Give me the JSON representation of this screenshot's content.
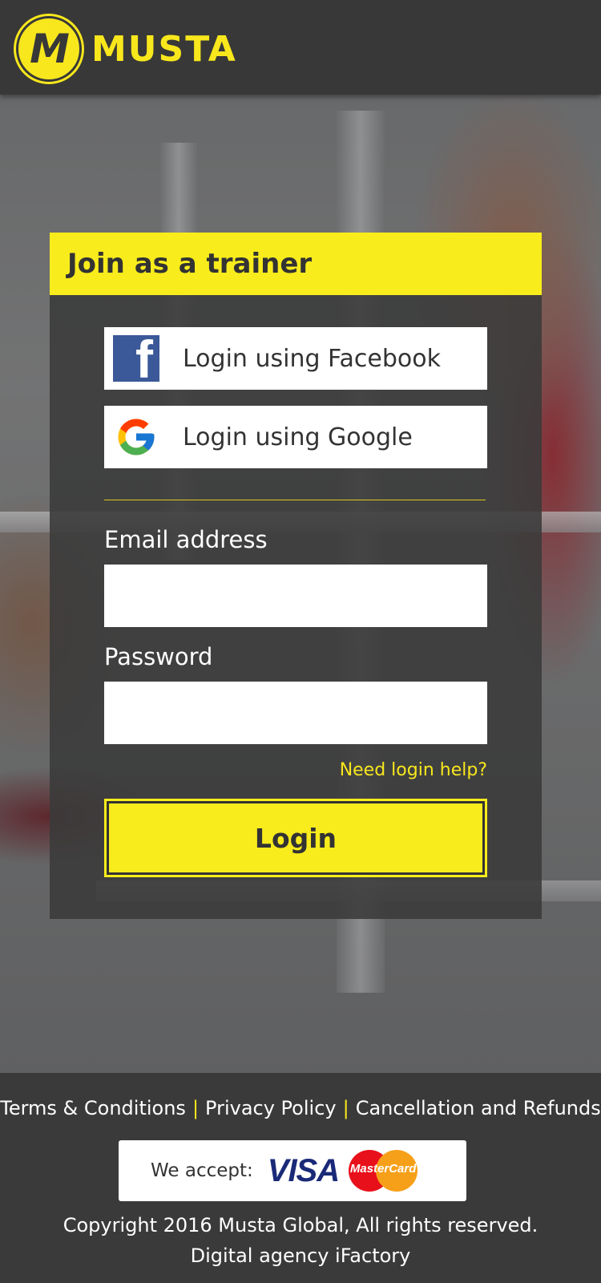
{
  "header": {
    "logo_letter": "M",
    "logo_text": "MUSTA"
  },
  "card": {
    "title": "Join as a trainer",
    "facebook_label": "Login using Facebook",
    "google_label": "Login using Google",
    "email_label": "Email address",
    "email_value": "",
    "password_label": "Password",
    "password_value": "",
    "help_link": "Need login help?",
    "login_label": "Login"
  },
  "footer": {
    "links": [
      "Terms & Conditions",
      "Privacy Policy",
      "Cancellation and Refunds"
    ],
    "separator": "|",
    "accept_label": "We accept:",
    "visa": "VISA",
    "mastercard": "MasterCard",
    "copyright": "Copyright 2016 Musta Global, All rights reserved.",
    "agency": "Digital agency iFactory"
  },
  "colors": {
    "accent": "#f8ec1c",
    "dark": "#3a3a3a",
    "facebook": "#3b5998"
  },
  "icons": {
    "facebook": "facebook-icon",
    "google": "google-icon"
  }
}
